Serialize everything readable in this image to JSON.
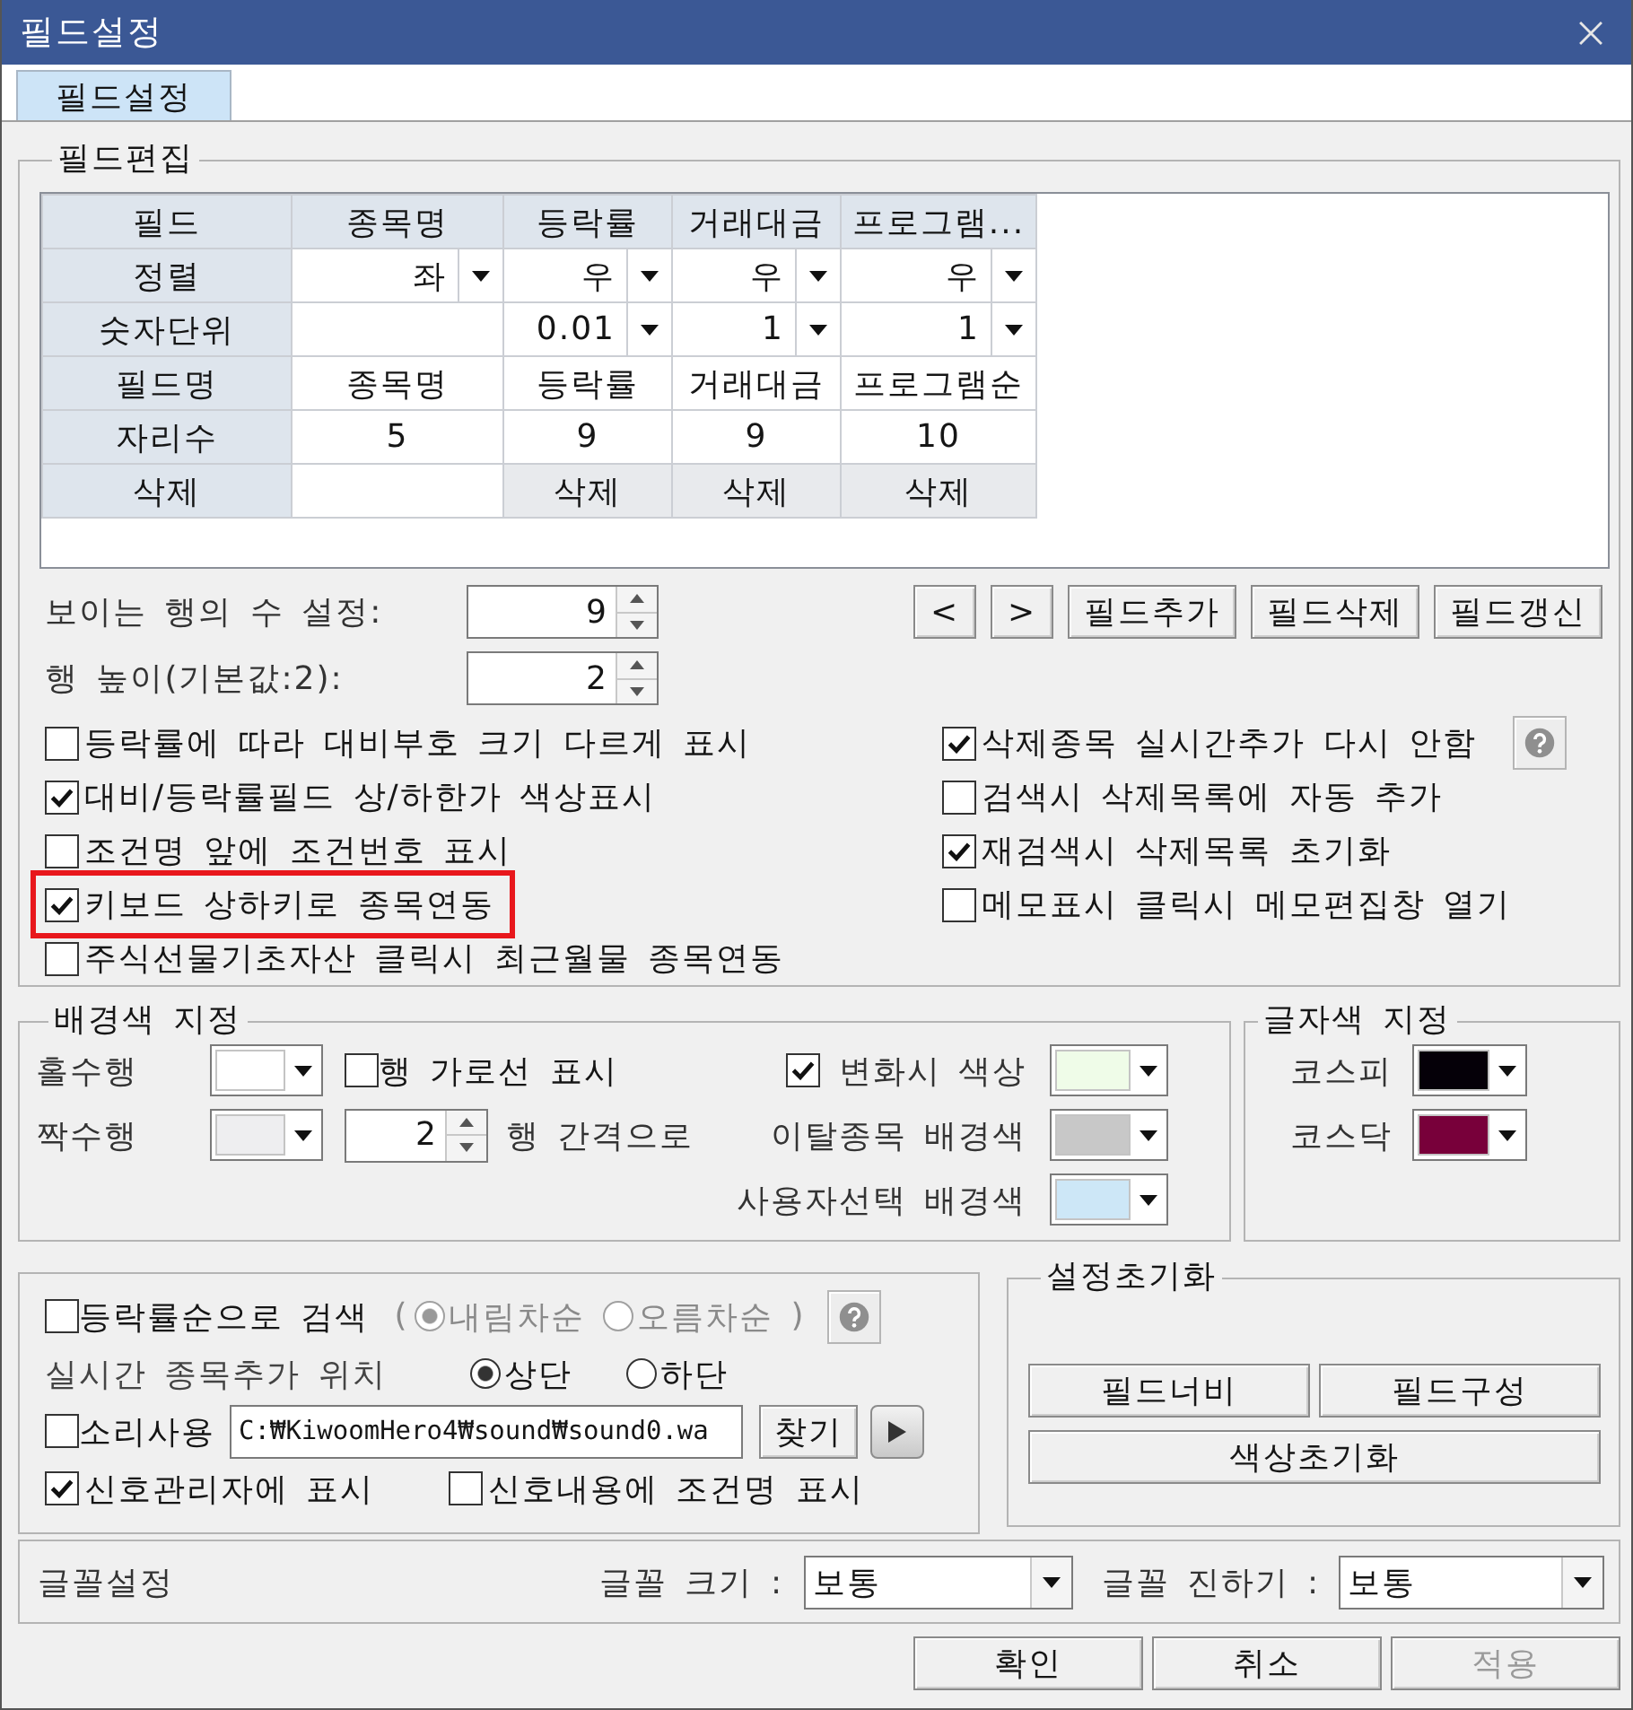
{
  "window": {
    "title": "필드설정"
  },
  "tabs": [
    {
      "label": "필드설정",
      "selected": true
    }
  ],
  "field_edit": {
    "title": "필드편집",
    "grid": {
      "rows": [
        {
          "kind": "header",
          "label": "필드",
          "cells": [
            {
              "kind": "text",
              "text": "종목명"
            },
            {
              "kind": "text",
              "text": "등락률"
            },
            {
              "kind": "text",
              "text": "거래대금"
            },
            {
              "kind": "text",
              "text": "프로그램..."
            }
          ]
        },
        {
          "kind": "body",
          "label": "정렬",
          "cells": [
            {
              "kind": "dropdown",
              "value": "좌"
            },
            {
              "kind": "dropdown",
              "value": "우"
            },
            {
              "kind": "dropdown",
              "value": "우"
            },
            {
              "kind": "dropdown",
              "value": "우"
            }
          ]
        },
        {
          "kind": "body",
          "label": "숫자단위",
          "cells": [
            {
              "kind": "empty"
            },
            {
              "kind": "dropdown",
              "value": "0.01"
            },
            {
              "kind": "dropdown",
              "value": "1"
            },
            {
              "kind": "dropdown",
              "value": "1"
            }
          ]
        },
        {
          "kind": "body",
          "label": "필드명",
          "cells": [
            {
              "kind": "text",
              "text": "종목명"
            },
            {
              "kind": "text",
              "text": "등락률"
            },
            {
              "kind": "text",
              "text": "거래대금"
            },
            {
              "kind": "text",
              "text": "프로그램순"
            }
          ]
        },
        {
          "kind": "body",
          "label": "자리수",
          "cells": [
            {
              "kind": "text",
              "text": "5"
            },
            {
              "kind": "text",
              "text": "9"
            },
            {
              "kind": "text",
              "text": "9"
            },
            {
              "kind": "text",
              "text": "10"
            }
          ]
        },
        {
          "kind": "body",
          "label": "삭제",
          "cells": [
            {
              "kind": "empty"
            },
            {
              "kind": "button",
              "text": "삭제"
            },
            {
              "kind": "button",
              "text": "삭제"
            },
            {
              "kind": "button",
              "text": "삭제"
            }
          ]
        }
      ]
    },
    "visible_rows": {
      "label": "보이는 행의 수 설정:",
      "value": "9"
    },
    "row_height": {
      "label": "행 높이(기본값:2):",
      "value": "2"
    },
    "nav_buttons": [
      "<",
      ">",
      "필드추가",
      "필드삭제",
      "필드갱신"
    ],
    "options_left": [
      {
        "label": "등락률에 따라 대비부호 크기 다르게 표시",
        "checked": false,
        "highlighted": false
      },
      {
        "label": "대비/등락률필드 상/하한가 색상표시",
        "checked": true,
        "highlighted": false
      },
      {
        "label": "조건명 앞에 조건번호 표시",
        "checked": false,
        "highlighted": false
      },
      {
        "label": "키보드 상하키로 종목연동",
        "checked": true,
        "highlighted": true
      },
      {
        "label": "주식선물기초자산 클릭시 최근월물 종목연동",
        "checked": false,
        "highlighted": false
      }
    ],
    "options_right": [
      {
        "label": "삭제종목 실시간추가 다시 안함",
        "checked": true
      },
      {
        "label": "검색시 삭제목록에 자동 추가",
        "checked": false
      },
      {
        "label": "재검색시 삭제목록 초기화",
        "checked": true
      },
      {
        "label": "메모표시 클릭시 메모편집창 열기",
        "checked": false
      }
    ]
  },
  "background": {
    "title": "배경색 지정",
    "odd": {
      "label": "홀수행",
      "color": "#ffffff"
    },
    "gridline": {
      "label": "행 가로선 표시",
      "checked": false
    },
    "even": {
      "label": "짝수행",
      "color": "#eeeef0"
    },
    "interval": {
      "value": "2",
      "label": "행 간격으로"
    },
    "colors": [
      {
        "kind": "checkbox",
        "label": "변화시 색상",
        "checked": true,
        "color": "#effce8"
      },
      {
        "kind": "label",
        "label": "이탈종목 배경색",
        "color": "#c8c8c8"
      },
      {
        "kind": "label",
        "label": "사용자선택 배경색",
        "color": "#cde7f7"
      }
    ]
  },
  "text_color": {
    "title": "글자색 지정",
    "items": [
      {
        "label": "코스피",
        "color": "#050008"
      },
      {
        "label": "코스닥",
        "color": "#78003a"
      }
    ]
  },
  "search_options": {
    "sort_search": {
      "label": "등락률순으로 검색",
      "checked": false
    },
    "open_paren": "(",
    "sort_orders": [
      {
        "label": "내림차순",
        "selected": true,
        "disabled": true
      },
      {
        "label": "오름차순",
        "selected": false,
        "disabled": true
      }
    ],
    "close_paren": ")",
    "insert_position": {
      "label": "실시간 종목추가 위치",
      "options": [
        {
          "label": "상단",
          "selected": true
        },
        {
          "label": "하단",
          "selected": false
        }
      ]
    },
    "sound": {
      "label": "소리사용",
      "checked": false,
      "path": "C:₩KiwoomHero4₩sound₩sound0.wa",
      "browse": "찾기"
    },
    "signal_options": [
      {
        "label": "신호관리자에 표시",
        "checked": true
      },
      {
        "label": "신호내용에 조건명 표시",
        "checked": false
      }
    ]
  },
  "reset": {
    "title": "설정초기화",
    "buttons": [
      "필드너비",
      "필드구성",
      "색상초기화"
    ]
  },
  "font": {
    "title": "글꼴설정",
    "size": {
      "label": "글꼴 크기 :",
      "value": "보통"
    },
    "weight": {
      "label": "글꼴 진하기 :",
      "value": "보통"
    }
  },
  "footer_buttons": [
    {
      "label": "확인",
      "disabled": false
    },
    {
      "label": "취소",
      "disabled": false
    },
    {
      "label": "적용",
      "disabled": true
    }
  ]
}
